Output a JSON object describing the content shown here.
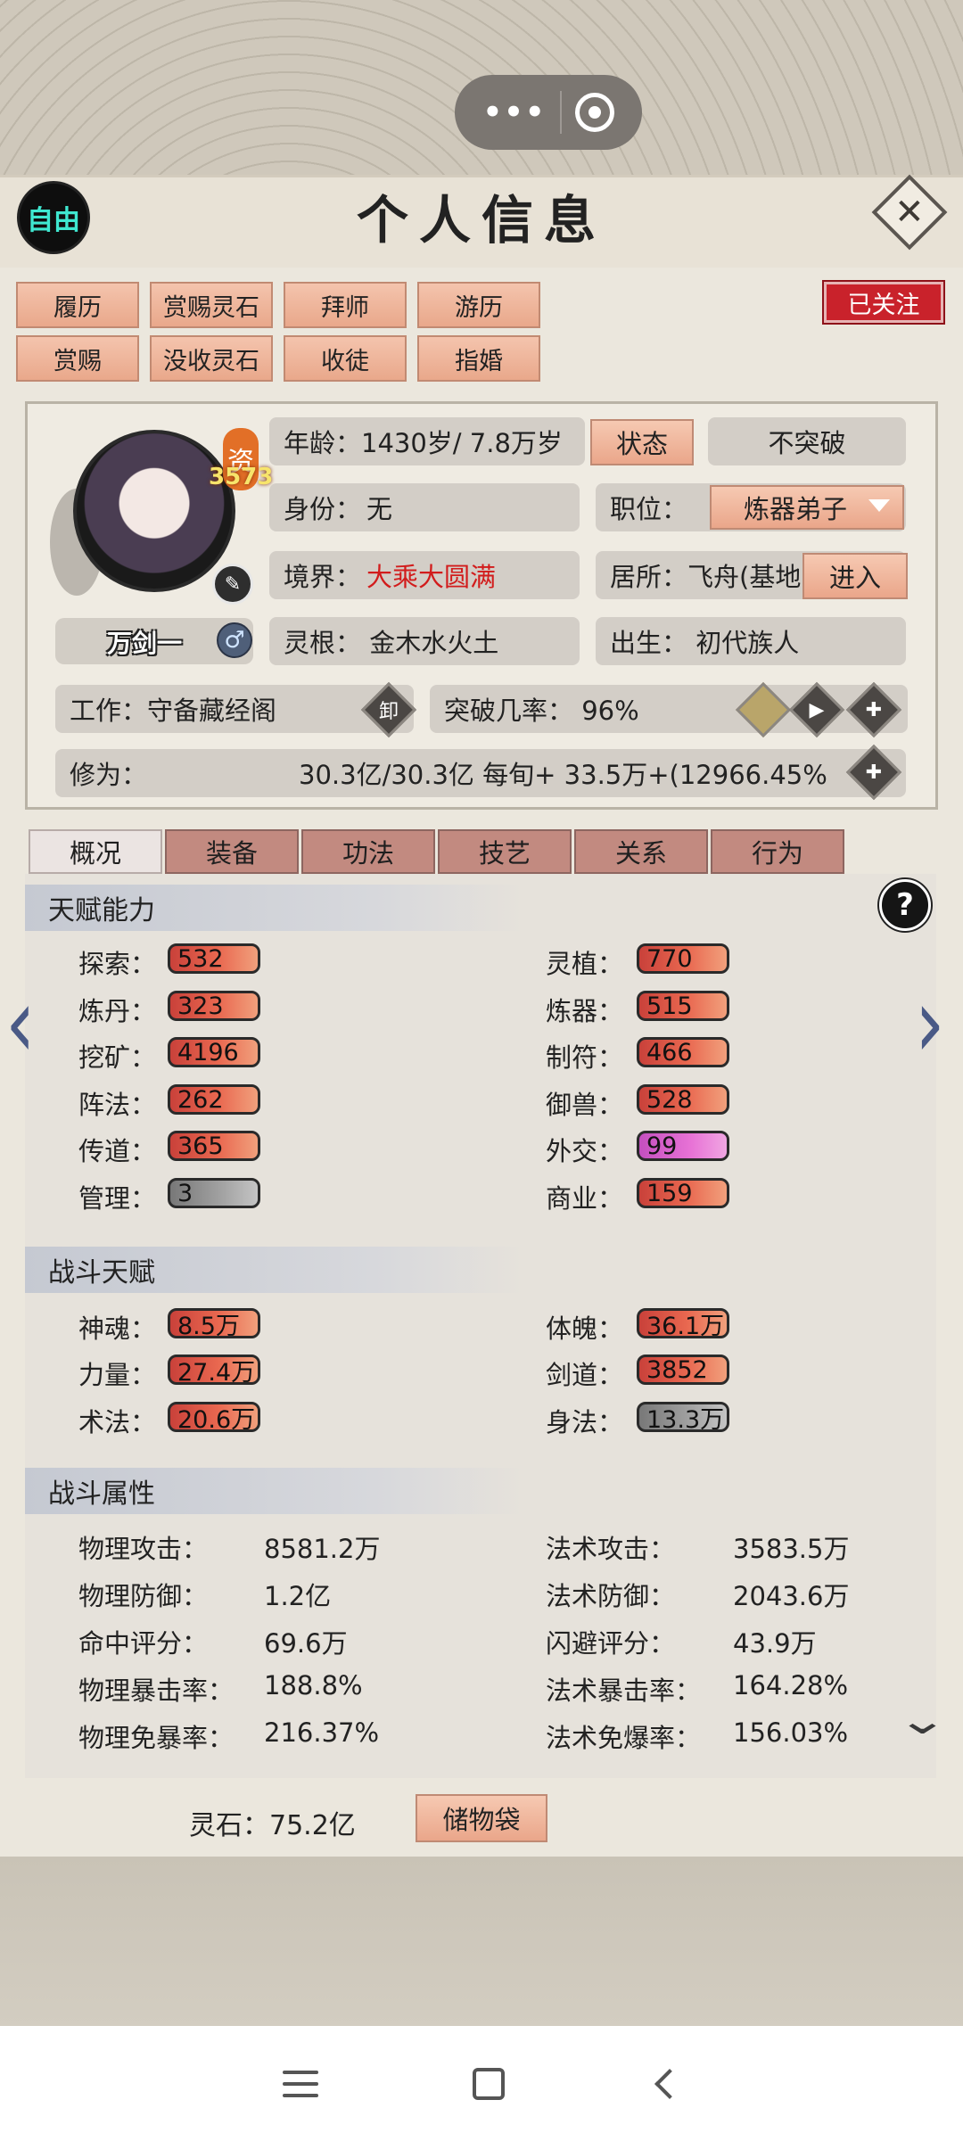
{
  "header": {
    "free_label": "自由",
    "title": "个人信息",
    "close_glyph": "✕"
  },
  "actions": {
    "row1": [
      "履历",
      "赏赐灵石",
      "拜师",
      "游历"
    ],
    "row2": [
      "赏赐",
      "没收灵石",
      "收徒",
      "指婚"
    ],
    "follow": "已关注"
  },
  "profile": {
    "qual_label": "资",
    "qual_value": "3573",
    "name": "万剑一",
    "gender_glyph": "♂",
    "age": "年龄：1430岁/ 7.8万岁",
    "status_btn": "状态",
    "breakthrough_btn": "不突破",
    "identity_label": "身份：",
    "identity_value": "无",
    "position_label": "职位：",
    "position_value": "炼器弟子",
    "realm_label": "境界：",
    "realm_value": "大乘大圆满",
    "residence": "居所：飞舟(基地",
    "enter_btn": "进入",
    "root": "灵根：  金木水火土",
    "birth": "出生：  初代族人",
    "job": "工作：守备藏经阁",
    "job_icon": "卸",
    "break_rate": "突破几率：  96%",
    "cultivation_label": "修为：",
    "cultivation_value": "30.3亿/30.3亿  每旬+   33.5万+(12966.45%"
  },
  "tabs": [
    "概况",
    "装备",
    "功法",
    "技艺",
    "关系",
    "行为"
  ],
  "talent": {
    "title": "天赋能力",
    "left": [
      {
        "label": "探索：",
        "value": "532",
        "color": "red"
      },
      {
        "label": "炼丹：",
        "value": "323",
        "color": "red"
      },
      {
        "label": "挖矿：",
        "value": "4196",
        "color": "red"
      },
      {
        "label": "阵法：",
        "value": "262",
        "color": "red"
      },
      {
        "label": "传道：",
        "value": "365",
        "color": "red"
      },
      {
        "label": "管理：",
        "value": "3",
        "color": "grey"
      }
    ],
    "right": [
      {
        "label": "灵植：",
        "value": "770",
        "color": "red"
      },
      {
        "label": "炼器：",
        "value": "515",
        "color": "red"
      },
      {
        "label": "制符：",
        "value": "466",
        "color": "red"
      },
      {
        "label": "御兽：",
        "value": "528",
        "color": "red"
      },
      {
        "label": "外交：",
        "value": "99",
        "color": "purple"
      },
      {
        "label": "商业：",
        "value": "159",
        "color": "red"
      }
    ]
  },
  "combat_talent": {
    "title": "战斗天赋",
    "left": [
      {
        "label": "神魂：",
        "value": "8.5万",
        "color": "red"
      },
      {
        "label": "力量：",
        "value": "27.4万",
        "color": "red"
      },
      {
        "label": "术法：",
        "value": "20.6万",
        "color": "red"
      }
    ],
    "right": [
      {
        "label": "体魄：",
        "value": "36.1万",
        "color": "red"
      },
      {
        "label": "剑道：",
        "value": "3852",
        "color": "red"
      },
      {
        "label": "身法：",
        "value": "13.3万",
        "color": "grey"
      }
    ]
  },
  "combat_attr": {
    "title": "战斗属性",
    "left": [
      {
        "label": "物理攻击：",
        "value": "8581.2万"
      },
      {
        "label": "物理防御：",
        "value": "1.2亿"
      },
      {
        "label": "命中评分：",
        "value": "69.6万"
      },
      {
        "label": "物理暴击率：",
        "value": "188.8%"
      },
      {
        "label": "物理免暴率：",
        "value": "216.37%"
      }
    ],
    "right": [
      {
        "label": "法术攻击：",
        "value": "3583.5万"
      },
      {
        "label": "法术防御：",
        "value": "2043.6万"
      },
      {
        "label": "闪避评分：",
        "value": "43.9万"
      },
      {
        "label": "法术暴击率：",
        "value": "164.28%"
      },
      {
        "label": "法术免爆率：",
        "value": "156.03%"
      }
    ]
  },
  "footer": {
    "spirit_stone": "灵石：75.2亿",
    "bag_btn": "储物袋"
  }
}
